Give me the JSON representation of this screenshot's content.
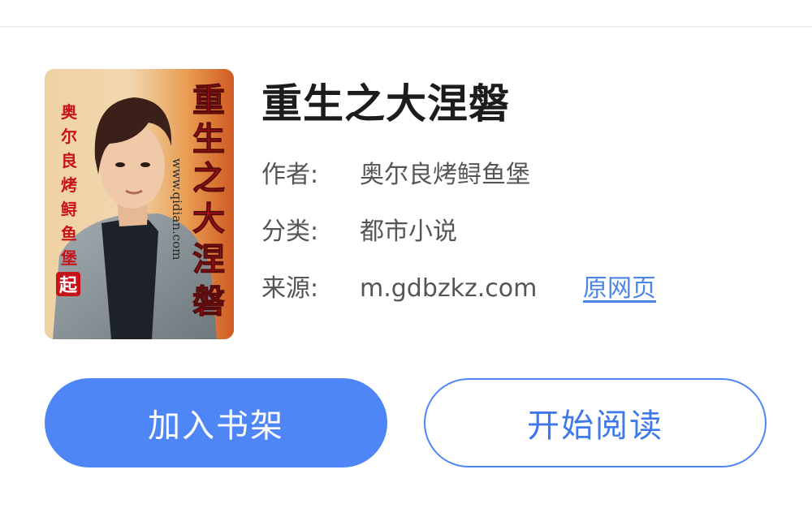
{
  "book": {
    "title": "重生之大涅磐",
    "cover": {
      "title_text": "重生之大涅磐",
      "author_text": "奥尔良烤鲟鱼堡",
      "site_text": "www.qidian.com",
      "badge_text": "起",
      "colors": {
        "background": "#e8b77e",
        "title_red": "#c8121a",
        "suit": "#8e979c",
        "shirt": "#1d2128",
        "skin": "#f0c9a8",
        "hair": "#3a2018"
      }
    }
  },
  "meta": {
    "author_label": "作者:",
    "author_value": "奥尔良烤鲟鱼堡",
    "category_label": "分类:",
    "category_value": "都市小说",
    "source_label": "来源:",
    "source_value": "m.gdbzkz.com",
    "origin_link": "原网页"
  },
  "actions": {
    "add_to_shelf": "加入书架",
    "start_reading": "开始阅读"
  },
  "colors": {
    "accent": "#4f86f7",
    "link": "#4a86e8",
    "text_primary": "#1c1c1c",
    "text_secondary": "#555555"
  }
}
